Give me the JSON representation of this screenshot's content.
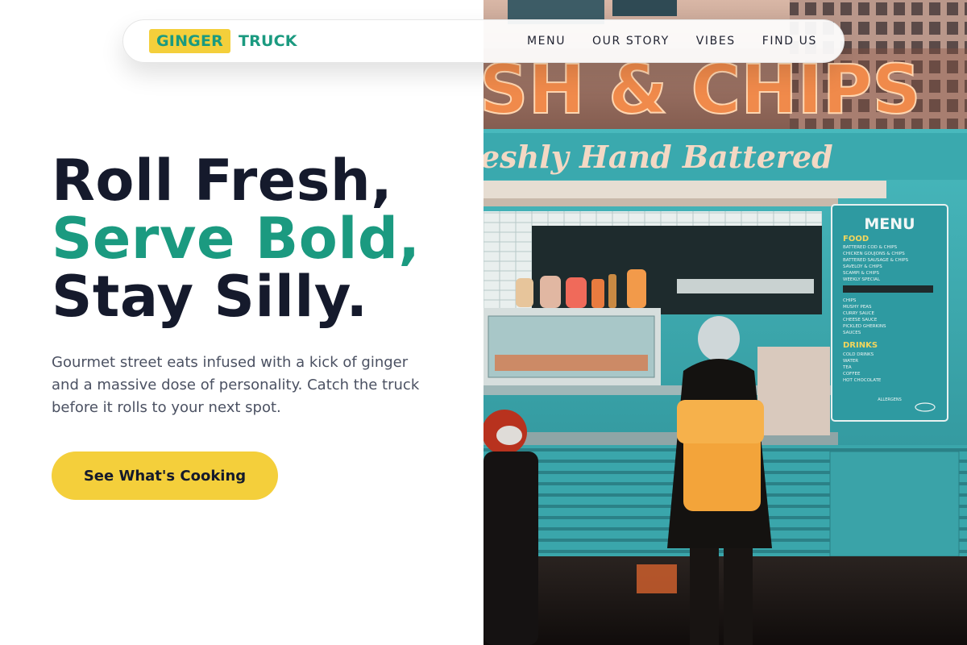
{
  "nav": {
    "logo_part1": "GINGER",
    "logo_part2": "TRUCK",
    "links": [
      "MENU",
      "OUR STORY",
      "VIBES",
      "FIND US"
    ]
  },
  "hero": {
    "line1": "Roll Fresh,",
    "line2": "Serve Bold,",
    "line3": "Stay Silly.",
    "description": "Gourmet street eats infused with a kick of ginger and a massive dose of personality. Catch the truck before it rolls to your next spot.",
    "cta_label": "See What's Cooking"
  },
  "photo": {
    "sign_top": "SH & CHIPS",
    "sign_script": "eshly Hand Battered",
    "menu_board": {
      "title": "MENU",
      "food_heading": "FOOD",
      "food_items": [
        "BATTERED COD & CHIPS",
        "CHICKEN GOUJONS & CHIPS",
        "BATTERED SAUSAGE & CHIPS",
        "SAVELOY & CHIPS",
        "SCAMPI & CHIPS",
        "WEEKLY SPECIAL"
      ],
      "side_items": [
        "CHIPS",
        "MUSHY PEAS",
        "CURRY SAUCE",
        "CHEESE SAUCE",
        "PICKLED GHERKINS",
        "SAUCES"
      ],
      "drinks_heading": "DRINKS",
      "drink_items": [
        "COLD DRINKS",
        "WATER",
        "TEA",
        "COFFEE",
        "HOT CHOCOLATE"
      ],
      "footer": "ALLERGENS"
    }
  },
  "colors": {
    "accent_green": "#1b9a80",
    "accent_yellow": "#f4cf3b",
    "heading_dark": "#151a2c",
    "body_text": "#4b5162",
    "truck_teal": "#3fb3b7"
  }
}
